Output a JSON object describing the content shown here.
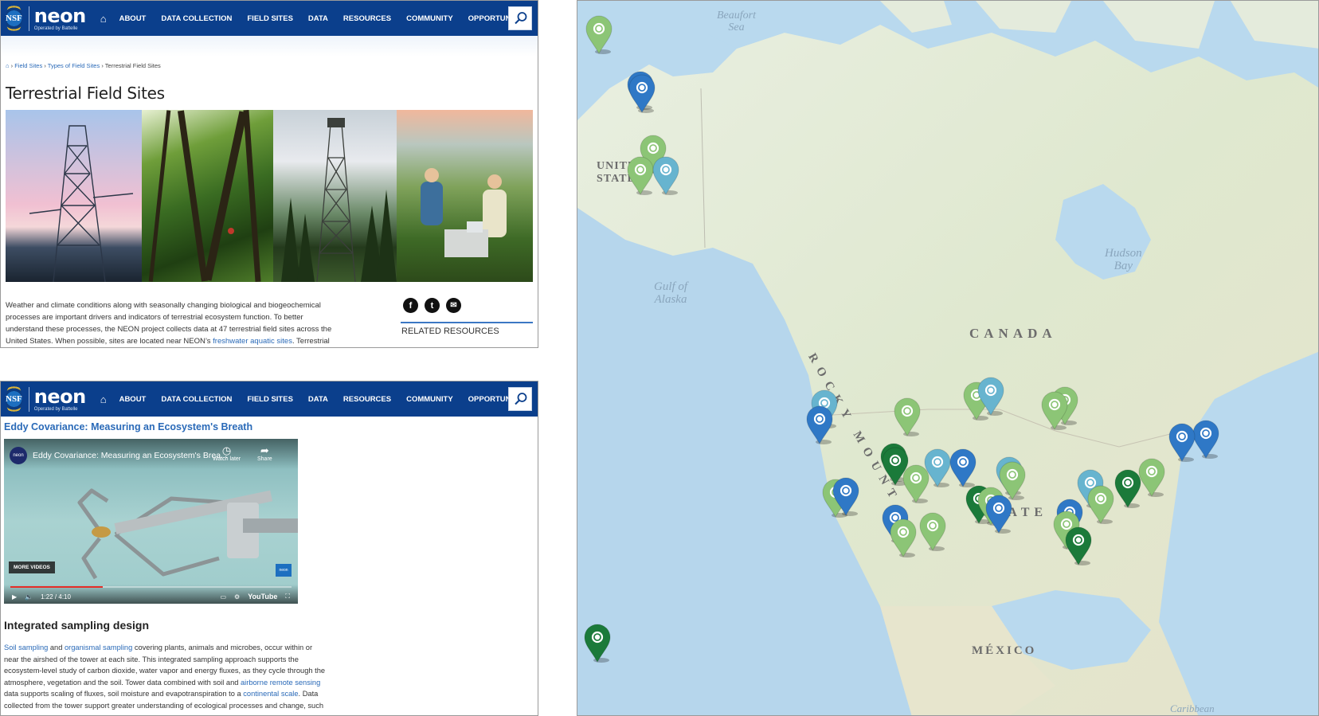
{
  "header": {
    "nsf_text": "NSF",
    "brand": "neon",
    "brand_sub": "Operated by Battelle",
    "nav": [
      "ABOUT",
      "DATA COLLECTION",
      "FIELD SITES",
      "DATA",
      "RESOURCES",
      "COMMUNITY",
      "OPPORTUNITIES"
    ]
  },
  "page_a": {
    "breadcrumb": {
      "sep": "›",
      "items": [
        "Field Sites",
        "Types of Field Sites",
        "Terrestrial Field Sites"
      ]
    },
    "title": "Terrestrial Field Sites",
    "body_lines": [
      "Weather and climate conditions along with seasonally changing biological and biogeochemical",
      "processes are important drivers and indicators of terrestrial ecosystem function. To better",
      "understand these processes, the NEON project collects data at 47 terrestrial field sites across the"
    ],
    "body_last_pre": "United States. When possible, sites are located near NEON’s ",
    "body_last_link": "freshwater aquatic sites",
    "body_last_post": ". Terrestrial",
    "share": [
      "f",
      "t",
      "✉"
    ],
    "related_resources": "RELATED RESOURCES"
  },
  "page_b": {
    "title": "Eddy Covariance: Measuring an Ecosystem's Breath",
    "video": {
      "channel": "neon",
      "title": "Eddy Covariance: Measuring an Ecosystem's Brea...",
      "watch_later": "Watch later",
      "share": "Share",
      "more_videos": "MORE VIDEOS",
      "time": "1:22 / 4:10",
      "progress": 0.33,
      "platform": "YouTube",
      "badge": "neon"
    },
    "h2": "Integrated sampling design",
    "p1_link_a": "Soil sampling",
    "p1_and": " and ",
    "p1_link_b": "organismal sampling",
    "p1_rest": " covering plants, animals and microbes, occur within or",
    "lines": [
      "near the airshed of the tower at each site. This integrated sampling approach supports the",
      "ecosystem-level study of carbon dioxide, water vapor and energy fluxes, as they cycle through the"
    ],
    "l4_pre": "atmosphere, vegetation and the soil. Tower data combined with soil and ",
    "l4_link": "airborne remote sensing",
    "l5_pre": "data supports scaling of fluxes, soil moisture and evapotranspiration to a ",
    "l5_link": "continental scale",
    "l5_post": ". Data",
    "l6": "collected from the tower support greater understanding of ecological processes and change, such"
  },
  "map": {
    "labels": {
      "beaufort": [
        "Beaufort",
        "Sea"
      ],
      "united_states_ak": [
        "UNITED",
        "STATES"
      ],
      "gulf_alaska": [
        "Gulf of",
        "Alaska"
      ],
      "hudson": [
        "Hudson",
        "Bay"
      ],
      "rocky": "ROCKY MOUNT",
      "canada": "CANADA",
      "us": "STATE",
      "mexico": "MÉXICO",
      "caribbean": "Caribbean"
    },
    "pin_colors": {
      "light_green": "#8cc576",
      "dark_green": "#1b7a3a",
      "blue": "#2f78c6",
      "light_blue": "#67b4cf"
    },
    "pins": [
      {
        "c": "light_green"
      },
      {
        "c": "blue"
      },
      {
        "c": "blue"
      },
      {
        "c": "light_green"
      },
      {
        "c": "light_green"
      },
      {
        "c": "light_blue"
      },
      {
        "c": "light_blue"
      },
      {
        "c": "blue"
      },
      {
        "c": "light_green"
      },
      {
        "c": "light_green"
      },
      {
        "c": "light_blue"
      },
      {
        "c": "light_green"
      },
      {
        "c": "light_green"
      },
      {
        "c": "blue"
      },
      {
        "c": "blue"
      },
      {
        "c": "dark_green"
      },
      {
        "c": "dark_green"
      },
      {
        "c": "light_green"
      },
      {
        "c": "light_blue"
      },
      {
        "c": "blue"
      },
      {
        "c": "light_blue"
      },
      {
        "c": "light_green"
      },
      {
        "c": "light_green"
      },
      {
        "c": "blue"
      },
      {
        "c": "dark_green"
      },
      {
        "c": "light_green"
      },
      {
        "c": "blue"
      },
      {
        "c": "light_blue"
      },
      {
        "c": "light_green"
      },
      {
        "c": "dark_green"
      },
      {
        "c": "light_green"
      },
      {
        "c": "blue"
      },
      {
        "c": "light_green"
      },
      {
        "c": "light_green"
      },
      {
        "c": "blue"
      },
      {
        "c": "light_green"
      },
      {
        "c": "dark_green"
      },
      {
        "c": "dark_green"
      }
    ]
  }
}
